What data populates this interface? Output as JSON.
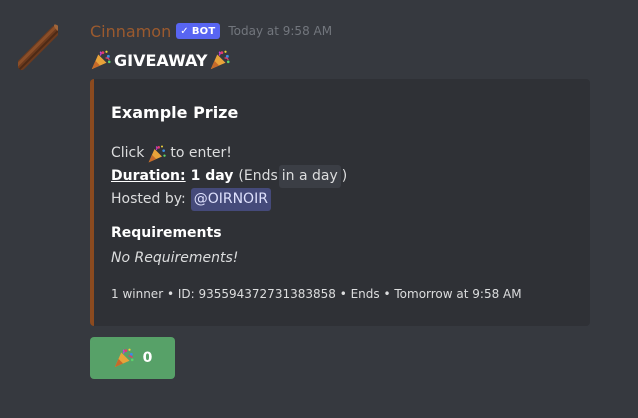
{
  "author": {
    "username": "Cinnamon",
    "bot_tag": "BOT",
    "bot_check": "✓",
    "timestamp": "Today at 9:58 AM",
    "name_color": "#9b5a2e"
  },
  "message": {
    "title": "GIVEAWAY",
    "title_emoji": "party-popper-icon"
  },
  "embed": {
    "accent_color": "#8b4a1f",
    "title": "Example Prize",
    "click_prefix": "Click",
    "click_suffix": "to enter!",
    "duration_label": "Duration:",
    "duration_value": "1 day",
    "ends_open": "(Ends",
    "ends_relative": "in a day",
    "ends_close": ")",
    "hosted_label": "Hosted by:",
    "host_mention": "@OIRNOIR",
    "requirements_name": "Requirements",
    "requirements_value": "No Requirements!",
    "footer": "1 winner • ID: 935594372731383858 • Ends • Tomorrow at 9:58 AM"
  },
  "reaction": {
    "emoji": "party-popper-icon",
    "count": "0",
    "color": "#57a168"
  }
}
